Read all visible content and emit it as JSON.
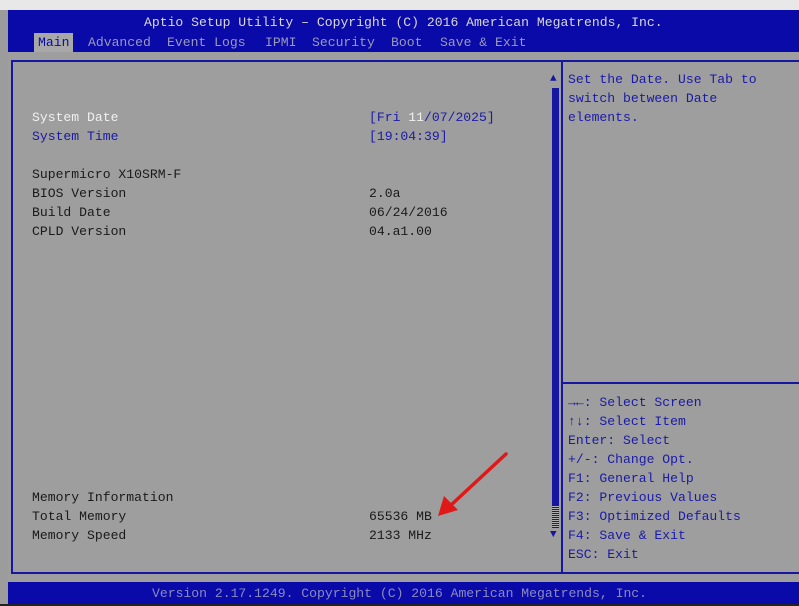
{
  "header": {
    "title": "Aptio Setup Utility – Copyright (C) 2016 American Megatrends, Inc.",
    "tabs": [
      "Main",
      "Advanced",
      "Event Logs",
      "IPMI",
      "Security",
      "Boot",
      "Save & Exit"
    ]
  },
  "main": {
    "system_date": {
      "label": "System Date",
      "prefix": "[Fri ",
      "selected": "11",
      "suffix": "/07/2025]"
    },
    "system_time": {
      "label": "System Time",
      "value": "[19:04:39]"
    },
    "board": "Supermicro X10SRM-F",
    "info": [
      {
        "label": "BIOS Version",
        "value": "2.0a"
      },
      {
        "label": "Build Date",
        "value": "06/24/2016"
      },
      {
        "label": "CPLD Version",
        "value": "04.a1.00"
      }
    ],
    "memory_heading": "Memory Information",
    "memory": [
      {
        "label": "Total Memory",
        "value": "65536 MB"
      },
      {
        "label": "Memory Speed",
        "value": "2133 MHz"
      }
    ]
  },
  "help": {
    "description": [
      "Set the Date. Use Tab to",
      "switch between Date",
      "elements."
    ],
    "keys": [
      "→←: Select Screen",
      "↑↓: Select Item",
      "Enter: Select",
      "+/-: Change Opt.",
      "F1: General Help",
      "F2: Previous Values",
      "F3: Optimized Defaults",
      "F4: Save & Exit",
      "ESC: Exit"
    ]
  },
  "footer": {
    "text": "Version 2.17.1249. Copyright (C) 2016 American Megatrends, Inc."
  },
  "colors": {
    "blue": "#0a0aa8",
    "gray": "#9e9e9e",
    "annotation": "#e01818"
  }
}
